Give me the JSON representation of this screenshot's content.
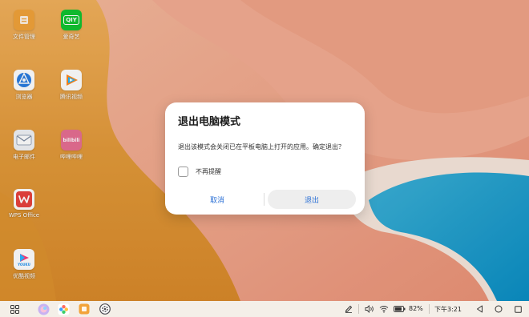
{
  "desktop": {
    "icons": [
      {
        "label": "文件管理",
        "icon": "file-manager-icon",
        "color": "#f2a33a"
      },
      {
        "label": "爱奇艺",
        "icon": "iqiyi-icon",
        "color": "#12c431"
      },
      {
        "label": "浏览器",
        "icon": "browser-icon",
        "color": "#ffffff"
      },
      {
        "label": "腾讯视频",
        "icon": "tencent-video-icon",
        "color": "#ffffff"
      },
      {
        "label": "电子邮件",
        "icon": "email-icon",
        "color": "#f1f3f6"
      },
      {
        "label": "哔哩哔哩",
        "icon": "bilibili-icon",
        "color": "#e76f93"
      },
      {
        "label": "WPS Office",
        "icon": "wps-office-icon",
        "color": "#ffffff"
      },
      {
        "label": "优酷视频",
        "icon": "youku-icon",
        "color": "#ffffff"
      }
    ],
    "iqiyi_text": "QIY",
    "bili_text": "bilibili",
    "youku_text": "YOUKU"
  },
  "dialog": {
    "title": "退出电脑模式",
    "message": "退出该模式会关闭已在平板电脑上打开的应用。确定退出？",
    "checkbox_label": "不再提醒",
    "checkbox_checked": false,
    "cancel_label": "取消",
    "exit_label": "退出",
    "accent": "#2e72d6"
  },
  "taskbar": {
    "battery": "82%",
    "time": "下午3:21",
    "icons": [
      "app-grid-icon",
      "gallery-icon",
      "photos-icon",
      "file-manager-icon",
      "settings-icon",
      "pen-icon",
      "volume-icon",
      "wifi-icon",
      "battery-icon",
      "back-icon",
      "home-icon",
      "recents-icon"
    ]
  }
}
